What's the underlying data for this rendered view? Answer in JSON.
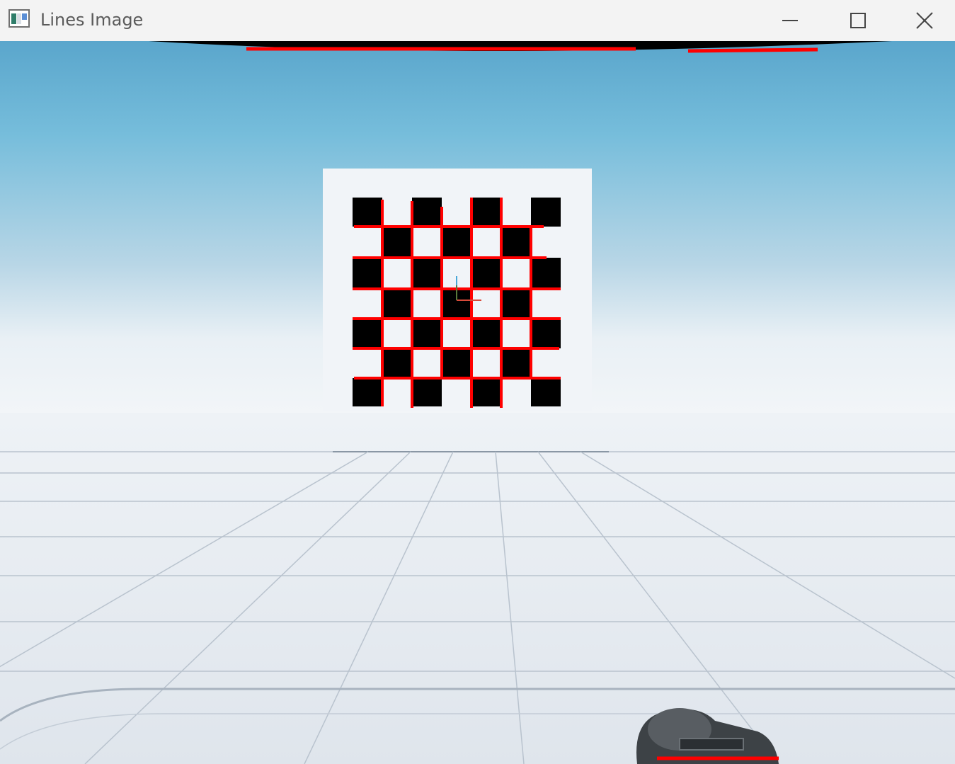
{
  "window": {
    "title": "Lines Image",
    "icons": {
      "app": "app-window-icon",
      "minimize": "minimize-icon",
      "maximize": "maximize-icon",
      "close": "close-icon"
    }
  },
  "scene": {
    "description_items": [
      "checkerboard-target",
      "detected-lines-overlay",
      "floor-grid",
      "camera-device"
    ],
    "overlay_color": "#ff0000",
    "sky_top_color": "#5aa6cc",
    "sky_bottom_color": "#f2f5f8",
    "floor_color": "#e3e8ee",
    "checker_dark": "#000000",
    "checker_light": "#f5f7fa"
  }
}
